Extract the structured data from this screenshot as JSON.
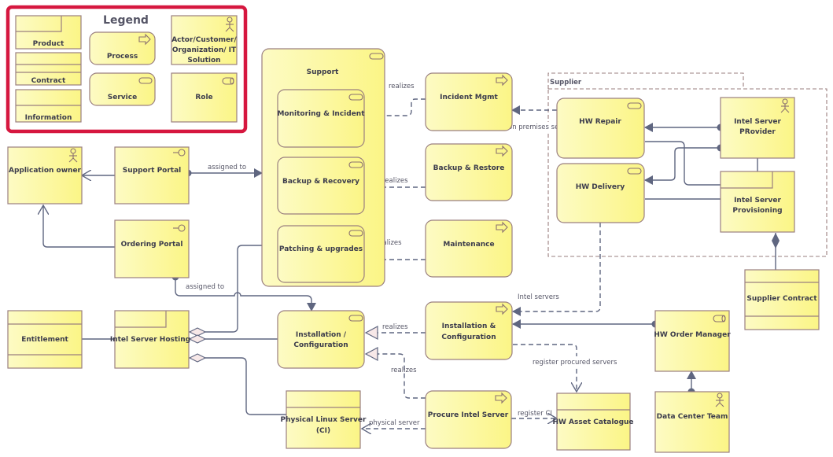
{
  "legend": {
    "title": "Legend",
    "items": [
      {
        "label": "Product",
        "kind": "product"
      },
      {
        "label": "Contract",
        "kind": "contract"
      },
      {
        "label": "Information",
        "kind": "information"
      },
      {
        "label": "Process",
        "kind": "process"
      },
      {
        "label": "Service",
        "kind": "service"
      },
      {
        "label": "Actor/Customer/ Organization/ IT Solution",
        "kind": "actor"
      },
      {
        "label": "Role",
        "kind": "role"
      }
    ],
    "border_color": "#d6173f"
  },
  "colors": {
    "fill": "#fdfaa8",
    "fill_dark": "#fbf58a",
    "border": "#9a7f7f",
    "edge": "#5f6680"
  },
  "group": {
    "label": "Supplier"
  },
  "nodes": {
    "application_owner": {
      "label": "Application owner",
      "kind": "actor",
      "icon": "actor-icon"
    },
    "support_portal": {
      "label": "Support Portal",
      "kind": "interface",
      "icon": "interface-icon"
    },
    "ordering_portal": {
      "label": "Ordering Portal",
      "kind": "interface",
      "icon": "interface-icon"
    },
    "support": {
      "label": "Support",
      "kind": "service",
      "icon": "service-icon"
    },
    "monitoring_incident": {
      "label": "Monitoring & Incident",
      "kind": "service",
      "icon": "service-icon"
    },
    "backup_recovery": {
      "label": "Backup & Recovery",
      "kind": "service",
      "icon": "service-icon"
    },
    "patching_upgrades": {
      "label": "Patching & upgrades",
      "kind": "service",
      "icon": "service-icon"
    },
    "incident_mgmt": {
      "label": "Incident Mgmt",
      "kind": "process",
      "icon": "process-icon"
    },
    "backup_restore": {
      "label": "Backup & Restore",
      "kind": "process",
      "icon": "process-icon"
    },
    "maintenance": {
      "label": "Maintenance",
      "kind": "process",
      "icon": "process-icon"
    },
    "hw_repair": {
      "label": "HW Repair",
      "kind": "service",
      "icon": "service-icon"
    },
    "hw_delivery": {
      "label": "HW Delivery",
      "kind": "service",
      "icon": "service-icon"
    },
    "intel_server_provider": {
      "label": "Intel Server PRovider",
      "line1": "Intel Server",
      "line2": "PRovider",
      "kind": "actor",
      "icon": "actor-icon"
    },
    "intel_server_provisioning": {
      "label": "Intel Server Provisioning",
      "line1": "Intel Server",
      "line2": "Provisioning",
      "kind": "product"
    },
    "supplier_contract": {
      "label": "Supplier Contract",
      "kind": "contract"
    },
    "entitlement": {
      "label": "Entitlement",
      "kind": "contract"
    },
    "intel_server_hosting": {
      "label": "Intel Server Hosting",
      "kind": "product"
    },
    "installation_configuration_svc": {
      "label": "Installation / Configuration",
      "line1": "Installation /",
      "line2": "Configuration",
      "kind": "service",
      "icon": "service-icon"
    },
    "installation_configuration_proc": {
      "label": "Installation & Configuration",
      "line1": "Installation &",
      "line2": "Configuration",
      "kind": "process",
      "icon": "process-icon"
    },
    "hw_order_manager": {
      "label": "HW Order Manager",
      "kind": "role",
      "icon": "role-icon"
    },
    "physical_linux_server": {
      "label": "Physical Linux Server (CI)",
      "line1": "Physical Linux Server",
      "line2": "(CI)",
      "kind": "information"
    },
    "procure_intel_server": {
      "label": "Procure Intel Server",
      "kind": "process",
      "icon": "process-icon"
    },
    "hw_asset_catalogue": {
      "label": "HW Asset Catalogue",
      "kind": "information"
    },
    "data_center_team": {
      "label": "Data Center Team",
      "kind": "actor",
      "icon": "actor-icon"
    }
  },
  "edges": {
    "support_portal_assigned": "assigned to",
    "ordering_portal_assigned": "assigned to",
    "incident_realizes": "realizes",
    "backup_realizes": "realizes",
    "maintenance_realizes": "realizes",
    "on_premises": "on premises service",
    "intel_servers": "Intel servers",
    "install_realizes": "realizes",
    "procure_realizes": "realizes",
    "register_procured": "register procured servers",
    "register_ci": "register CI",
    "physical_server": "physical server"
  }
}
